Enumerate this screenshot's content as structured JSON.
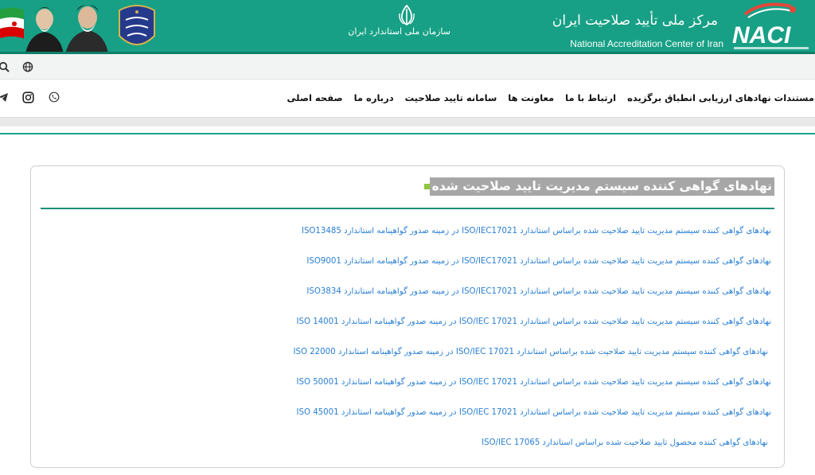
{
  "header": {
    "org_name": "سازمان ملی استاندارد ایران",
    "center_name_fa": "مرکز ملی تأیید صلاحیت ایران",
    "center_name_en": "National Accreditation Center of Iran",
    "logo_text": "NACI",
    "colors": {
      "banner": "#17a085",
      "text": "#ffffff"
    }
  },
  "utility_bar": {
    "icons": [
      "search-icon",
      "globe-icon"
    ]
  },
  "nav": {
    "items": [
      "صفحه اصلی",
      "درباره ما",
      "سامانه تایید صلاحیت",
      "معاونت ها",
      "ارتباط با ما",
      "مستندات نهادهای ارزیابی انطباق برگزیده"
    ],
    "social_icons": [
      "phone-icon",
      "instagram-icon",
      "telegram-icon"
    ]
  },
  "content": {
    "title": "نهادهای گواهی کننده سیستم مدیریت تایید صلاحیت شده",
    "links": [
      "نهادهای گواهی کننده سیستم مدیریت تایید صلاحیت شده براساس استاندارد ISO/IEC17021 در زمینه صدور گواهینامه استاندارد ISO13485",
      "نهادهای گواهی کننده سیستم مدیریت تایید صلاحیت شده براساس استاندارد ISO/IEC17021 در زمینه صدور گواهینامه استاندارد ISO9001",
      "نهادهای گواهی کننده سیستم مدیریت تایید صلاحیت شده براساس استاندارد ISO/IEC17021 در زمینه صدور گواهینامه استاندارد ISO3834",
      "نهادهای گواهی کننده سیستم مدیریت تایید صلاحیت شده براساس استاندارد ISO/IEC 17021 در زمینه صدور گواهینامه استاندارد ISO 14001",
      "نهادهای گواهی کننده سیستم مدیریت تایید صلاحیت شده براساس استاندارد ISO/IEC 17021 در زمینه صدور گواهینامه استاندارد ISO 22000",
      "نهادهای گواهی کننده سیستم مدیریت تایید صلاحیت شده براساس استاندارد ISO/IEC 17021 در زمینه صدور گواهینامه استاندارد ISO 50001",
      "نهادهای گواهی کننده سیستم مدیریت تایید صلاحیت شده براساس استاندارد ISO/IEC 17021 در زمینه صدور گواهینامه استاندارد ISO 45001",
      "نهادهای گواهی کننده محصول تایید صلاحیت شده براساس استاندارد ISO/IEC 17065"
    ],
    "colors": {
      "link": "#2a7fd3",
      "rule": "#1a8f78",
      "bullet": "#8dc63f"
    }
  }
}
